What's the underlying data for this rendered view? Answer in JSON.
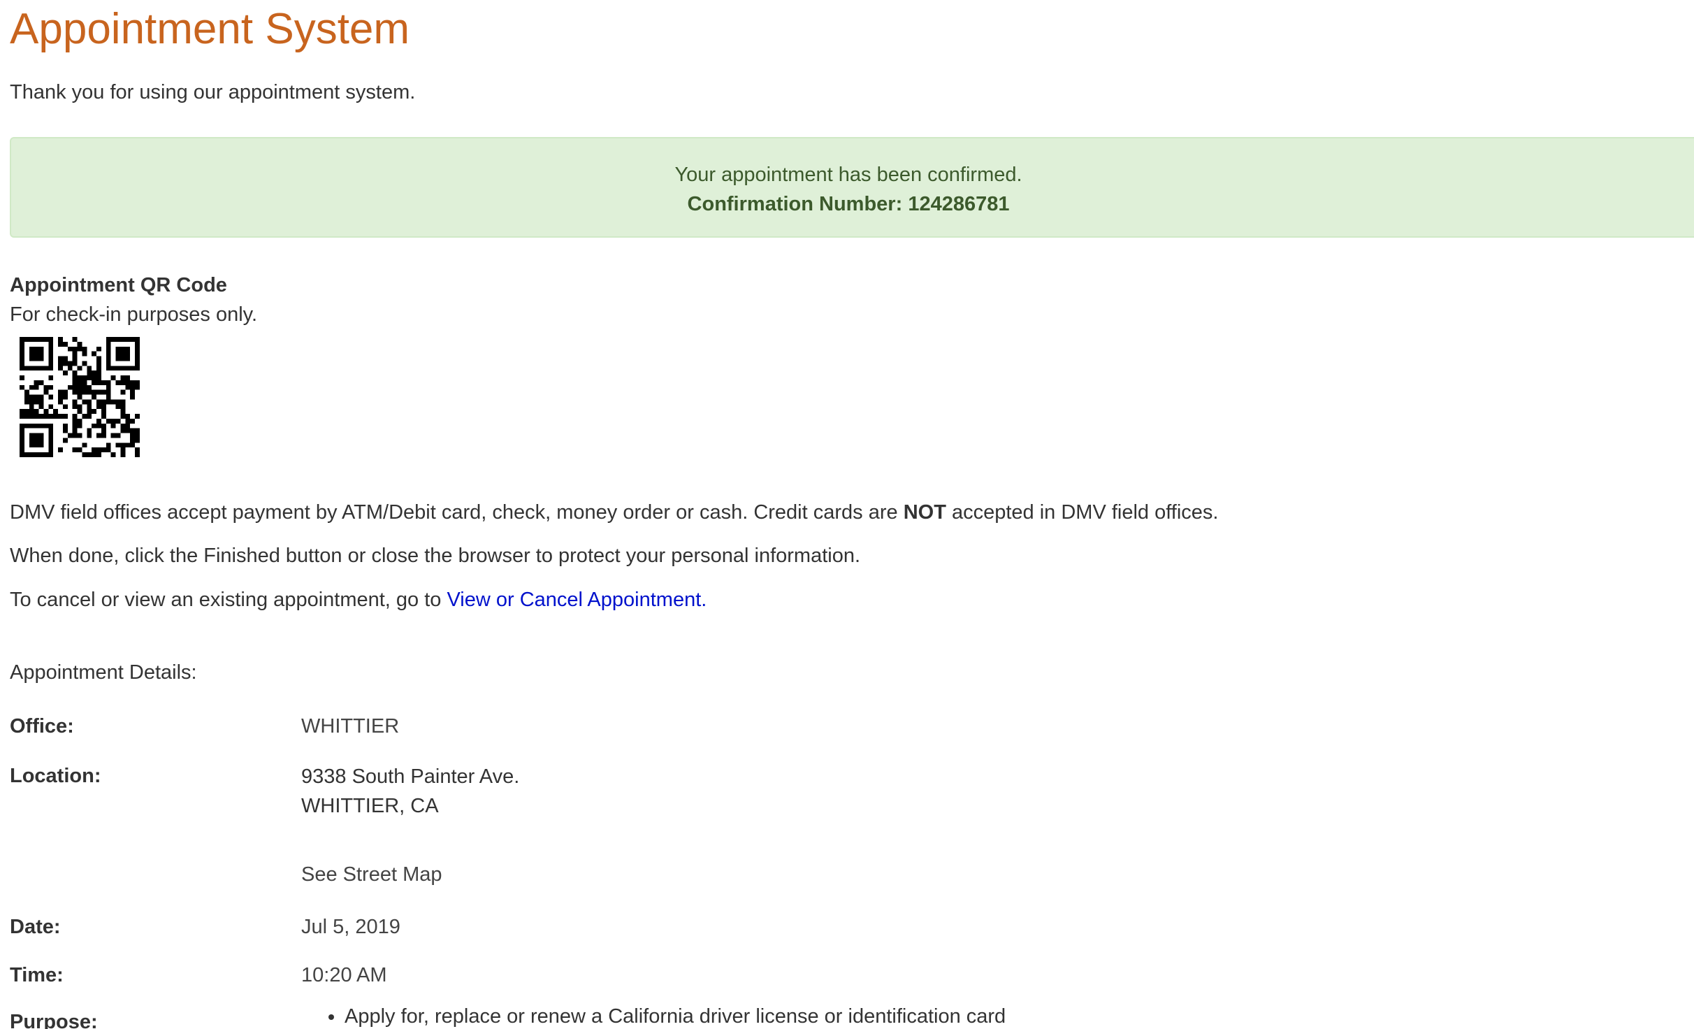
{
  "page": {
    "title": "Appointment System",
    "thanks": "Thank you for using our appointment system."
  },
  "alert": {
    "message": "Your appointment has been confirmed.",
    "confirmation_label": "Confirmation Number:",
    "confirmation_number": "124286781",
    "color": "#dff0d8"
  },
  "qr": {
    "heading": "Appointment QR Code",
    "subtext": "For check-in purposes only."
  },
  "info": {
    "payment_text_1": "DMV field offices accept payment by ATM/Debit card, check, money order or cash. Credit cards are ",
    "payment_emphasis": "NOT",
    "payment_text_2": " accepted in DMV field offices.",
    "finished_text": "When done, click the Finished button or close the browser to protect your personal information.",
    "cancel_text": "To cancel or view an existing appointment, go to ",
    "cancel_link": "View or Cancel Appointment."
  },
  "details": {
    "heading": "Appointment Details:",
    "office_label": "Office:",
    "office": "WHITTIER",
    "location_label": "Location:",
    "address_line1": "9338 South Painter Ave.",
    "address_line2": "WHITTIER, CA",
    "map_link": "See Street Map",
    "date_label": "Date:",
    "date": "Jul 5, 2019",
    "time_label": "Time:",
    "time": "10:20 AM",
    "purpose_label": "Purpose:",
    "purposes": [
      "Apply for, replace or renew a California driver license or identification card"
    ]
  },
  "colors": {
    "title": "#c8641e",
    "link": "#0011cc",
    "alert_text": "#3c5a2c"
  }
}
